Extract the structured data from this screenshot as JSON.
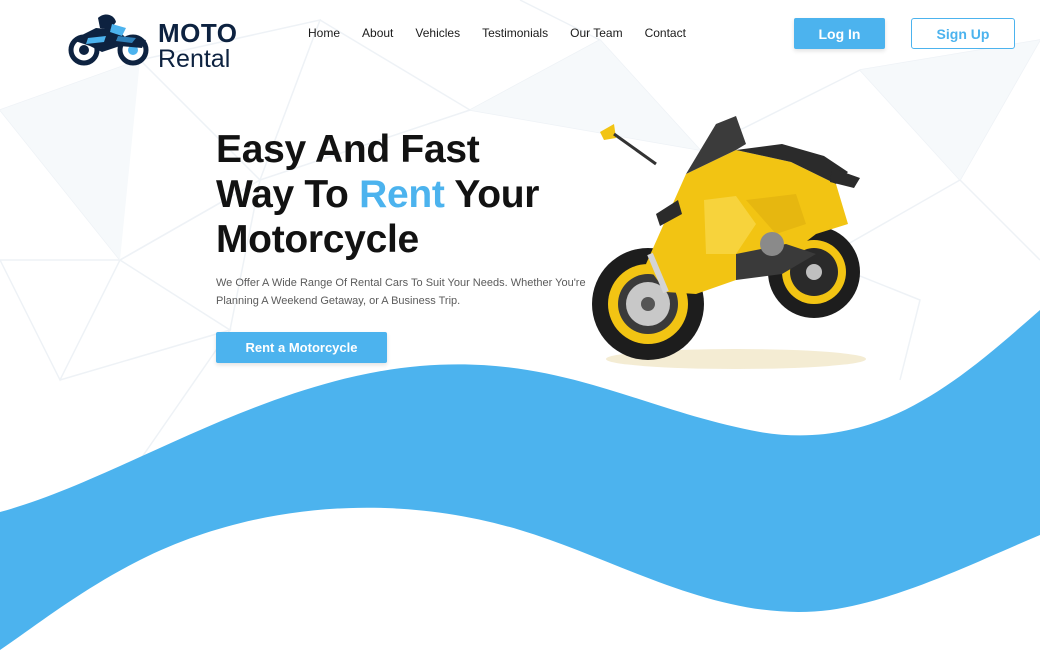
{
  "brand": {
    "logo_icon": "motorcycle-rider-icon",
    "line1": "MOTO",
    "line2": "Rental",
    "color": "#0d2240"
  },
  "nav": {
    "items": [
      {
        "label": "Home"
      },
      {
        "label": "About"
      },
      {
        "label": "Vehicles"
      },
      {
        "label": "Testimonials"
      },
      {
        "label": "Our Team"
      },
      {
        "label": "Contact"
      }
    ]
  },
  "auth": {
    "login_label": "Log In",
    "signup_label": "Sign Up"
  },
  "hero": {
    "title_part1": "Easy And Fast",
    "title_part2": "Way To",
    "title_accent": "Rent",
    "title_part3": "Your",
    "title_part4": "Motorcycle",
    "description": "We Offer A Wide Range Of Rental Cars To Suit Your Needs. Whether You're Planning A Weekend Getaway, or A Business Trip.",
    "cta_label": "Rent a Motorcycle",
    "image": "yellow-sport-motorcycle"
  },
  "colors": {
    "accent": "#4cb3ee",
    "text": "#121212",
    "muted": "#5b5b5b",
    "background": "#ffffff"
  }
}
